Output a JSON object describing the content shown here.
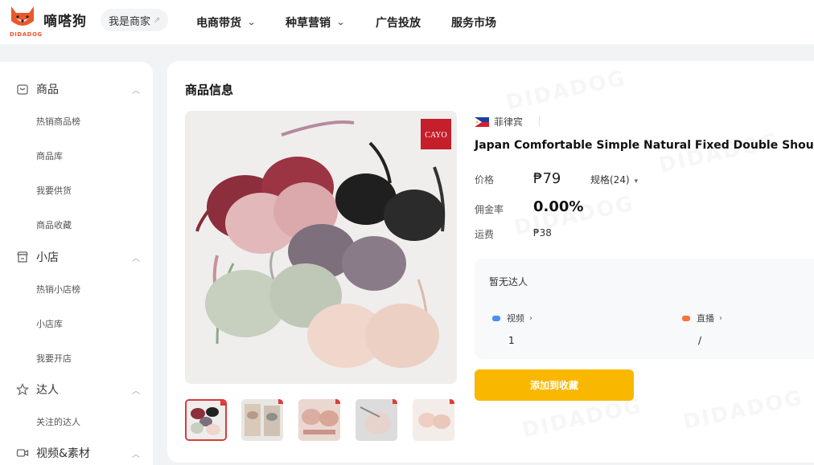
{
  "app": {
    "name": "嘀嗒狗",
    "brand": "DIDADOG",
    "accent": "#e9582e"
  },
  "header": {
    "merchant_label": "我是商家",
    "nav": [
      {
        "label": "电商带货",
        "has_dropdown": true
      },
      {
        "label": "种草营销",
        "has_dropdown": true
      },
      {
        "label": "广告投放",
        "has_dropdown": false
      },
      {
        "label": "服务市场",
        "has_dropdown": false
      }
    ]
  },
  "sidebar": {
    "groups": [
      {
        "label": "商品",
        "icon": "bag-icon",
        "items": [
          "热销商品榜",
          "商品库",
          "我要供货",
          "商品收藏"
        ]
      },
      {
        "label": "小店",
        "icon": "store-icon",
        "items": [
          "热销小店榜",
          "小店库",
          "我要开店"
        ]
      },
      {
        "label": "达人",
        "icon": "star-icon",
        "items": [
          "关注的达人"
        ]
      },
      {
        "label": "视频&素材",
        "icon": "video-icon",
        "items": []
      }
    ]
  },
  "product": {
    "section_title": "商品信息",
    "watermark": "DIDADOG",
    "image_badge": "CAYO",
    "country": "菲律宾",
    "title": "Japan Comfortable Simple Natural Fixed Double Shoulder",
    "price_label": "价格",
    "price": "₱79",
    "spec_label": "规格(24)",
    "commission_label": "佣金率",
    "commission": "0.00%",
    "shipping_label": "运费",
    "shipping": "₱38",
    "thumbnail_count": 5
  },
  "talent": {
    "heading": "暂无达人",
    "stats": [
      {
        "label": "视频",
        "value": "1",
        "color": "#4a8ff7"
      },
      {
        "label": "直播",
        "value": "/",
        "color": "#f5753b"
      }
    ]
  },
  "actions": {
    "add_to_collection": "添加到收藏"
  }
}
